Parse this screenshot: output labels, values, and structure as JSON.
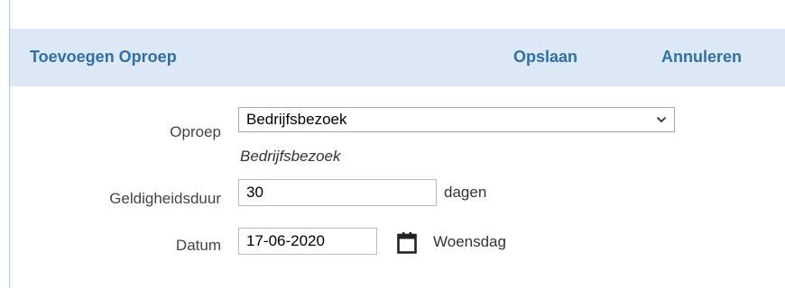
{
  "header": {
    "title": "Toevoegen Oproep",
    "save_label": "Opslaan",
    "cancel_label": "Annuleren"
  },
  "form": {
    "oproep": {
      "label": "Oproep",
      "selected": "Bedrijfsbezoek",
      "description": "Bedrijfsbezoek"
    },
    "geldigheidsduur": {
      "label": "Geldigheidsduur",
      "value": "30",
      "unit": "dagen"
    },
    "datum": {
      "label": "Datum",
      "value": "17-06-2020",
      "weekday": "Woensdag",
      "icon": "calendar-icon"
    }
  },
  "colors": {
    "header_background": "#dde9f6",
    "header_text": "#2f6fa8",
    "label_text": "#444444"
  }
}
